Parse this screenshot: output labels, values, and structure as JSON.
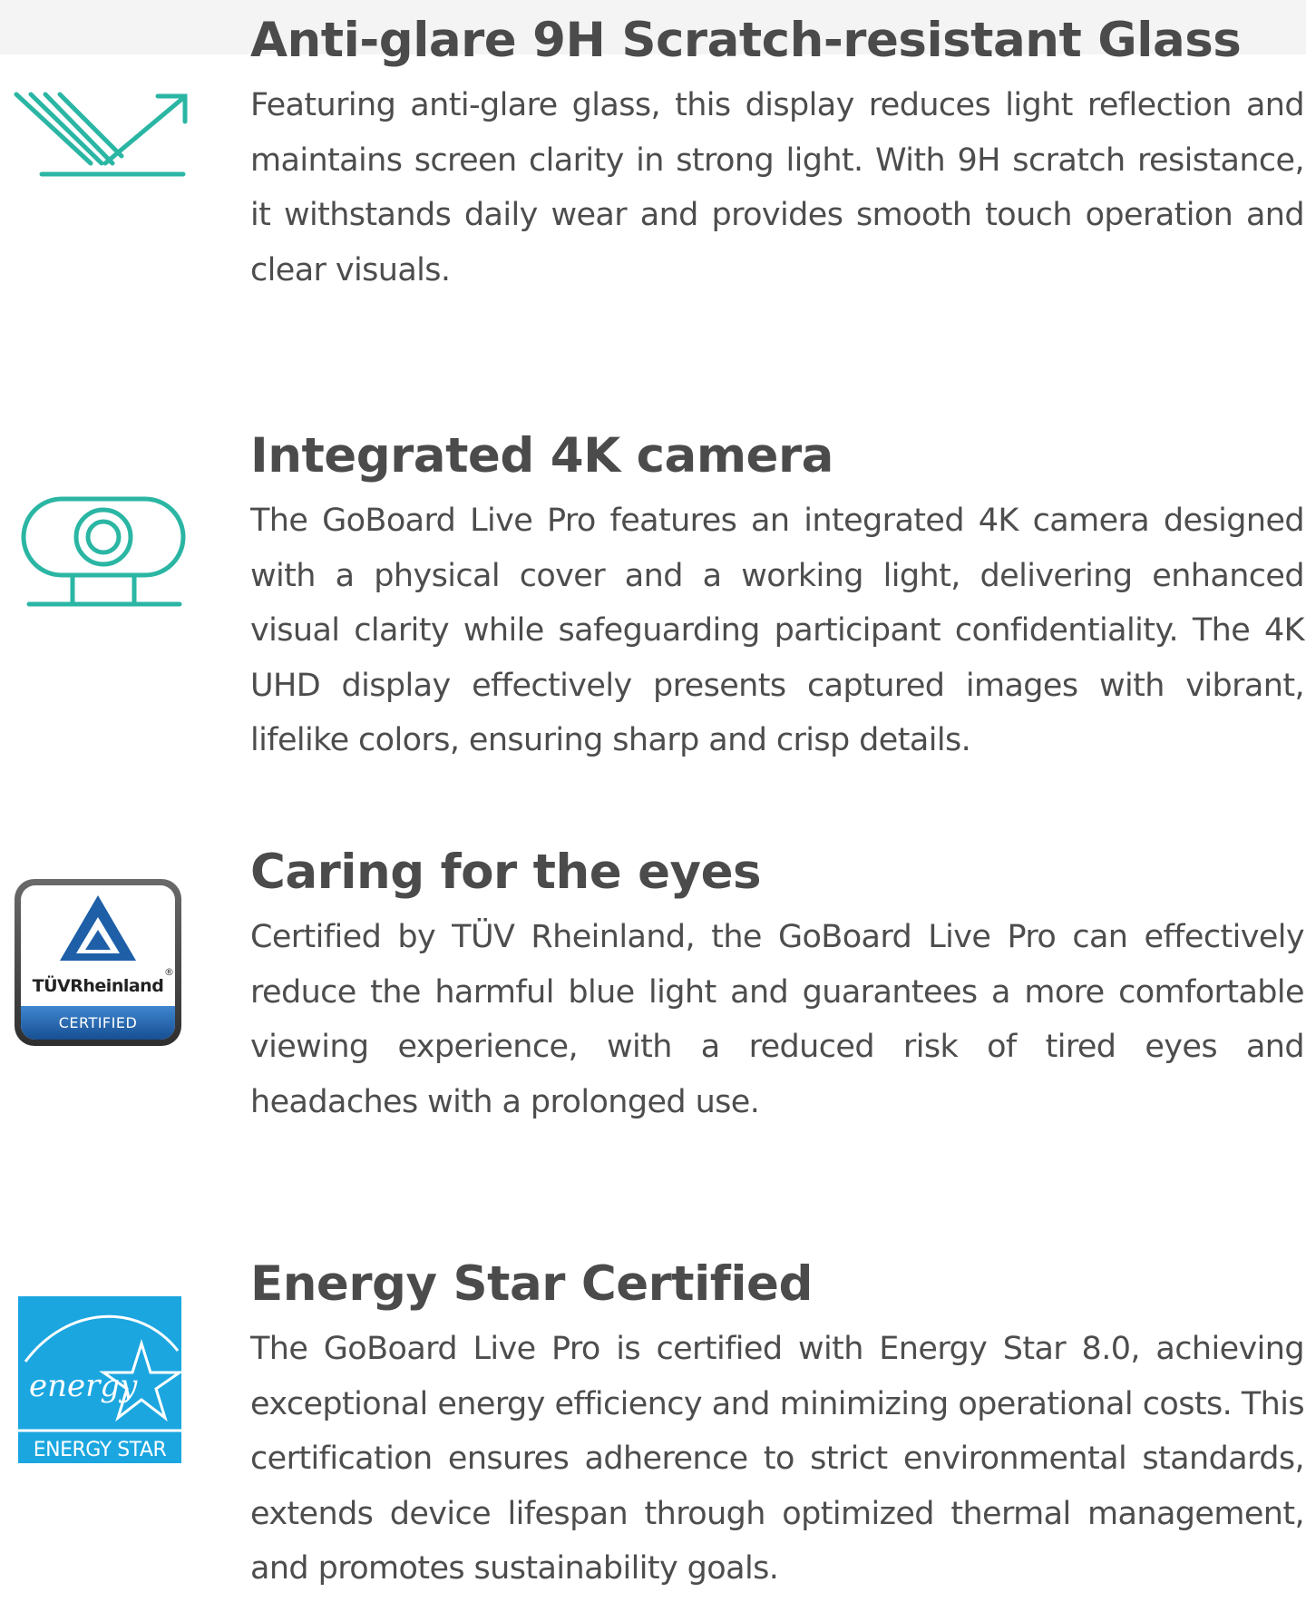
{
  "colors": {
    "accent_teal": "#2bb6a4",
    "title_gray": "#4b4b4b",
    "body_gray": "#4d4d4d",
    "tuv_blue": "#1e5fa8",
    "energy_star_blue": "#1ba6e0"
  },
  "features": [
    {
      "icon": "anti-glare-glass-icon",
      "title": "Anti-glare 9H Scratch-resistant Glass",
      "description": "Featuring anti-glare glass, this display reduces light reflection and maintains screen clarity in strong light. With 9H scratch resistance, it withstands daily wear and provides smooth touch operation and clear visuals."
    },
    {
      "icon": "camera-icon",
      "title": "Integrated 4K camera",
      "description": "The GoBoard Live Pro features an integrated 4K camera designed with a physical cover and a working light, delivering enhanced visual clarity while safeguarding participant confidentiality. The 4K UHD display effectively presents captured images with vibrant, lifelike colors, ensuring sharp and crisp details."
    },
    {
      "icon": "tuv-rheinland-certified-logo",
      "title": "Caring for the eyes",
      "description": "Certified by TÜV Rheinland, the GoBoard Live Pro can effectively reduce the harmful blue light and guarantees a more comfortable viewing experience, with a reduced risk of tired eyes and headaches with a prolonged use.",
      "badge_brand": "TÜVRheinland",
      "badge_text": "CERTIFIED"
    },
    {
      "icon": "energy-star-logo",
      "title": "Energy Star Certified",
      "description": "The GoBoard Live Pro is certified with Energy Star 8.0, achieving exceptional energy efficiency and minimizing operational costs. This certification ensures adherence to strict environmental standards, extends device lifespan through optimized thermal management, and promotes sustainability goals.",
      "badge_script": "energy",
      "badge_text": "ENERGY STAR"
    }
  ]
}
